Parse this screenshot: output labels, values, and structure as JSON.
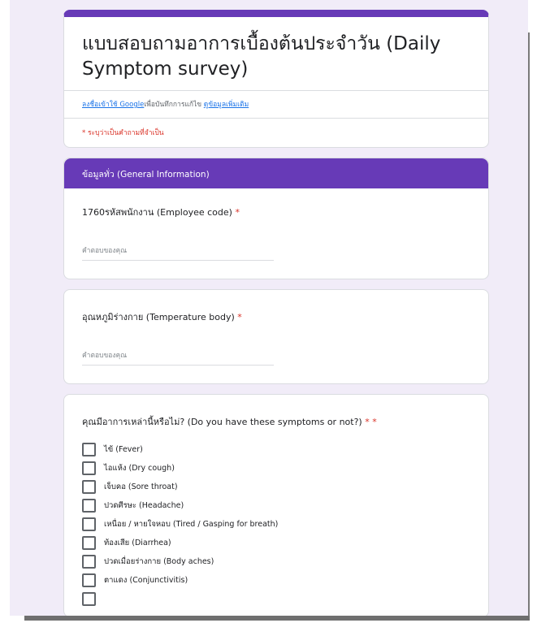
{
  "form": {
    "title": "แบบสอบถามอาการเบื้องต้นประจำวัน (Daily Symptom survey)",
    "login_link": "ลงชื่อเข้าใช้ Google",
    "login_text": "เพื่อบันทึกการแก้ไข",
    "learn_more": "ดูข้อมูลเพิ่มเติม",
    "required_note": "* ระบุว่าเป็นคำถามที่จำเป็น"
  },
  "section": {
    "title": "ข้อมูลทั่ว (General Information)"
  },
  "questions": [
    {
      "label": "1760รหัสพนักงาน (Employee code)",
      "required": "*",
      "placeholder": "คำตอบของคุณ"
    },
    {
      "label": "อุณหภูมิร่างกาย (Temperature body)",
      "required": "*",
      "placeholder": "คำตอบของคุณ"
    }
  ],
  "symptoms": {
    "label": "คุณมีอาการเหล่านี้หรือไม่? (Do you have these symptoms or not?)",
    "required": "* *",
    "options": [
      "ไข้ (Fever)",
      "ไอแห้ง (Dry cough)",
      "เจ็บคอ (Sore throat)",
      "ปวดศีรษะ (Headache)",
      "เหนื่อย / หายใจหอบ (Tired / Gasping for breath)",
      "ท้องเสีย (Diarrhea)",
      "ปวดเมื่อยร่างกาย (Body aches)",
      "ตาแดง (Conjunctivitis)"
    ]
  },
  "colors": {
    "accent": "#673ab7",
    "background": "#f1ecf8",
    "required": "#d93025",
    "link": "#1a73e8"
  }
}
